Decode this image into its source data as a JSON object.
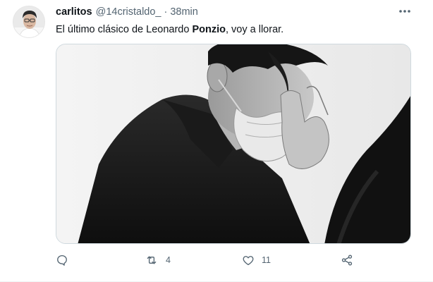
{
  "tweet": {
    "author_name": "carlitos",
    "author_handle": "@14cristaldo_",
    "separator": "·",
    "time": "38min",
    "text_before": "El último clásico de Leonardo ",
    "text_bold": "Ponzio",
    "text_after": ", voy a llorar.",
    "media_alt": "Imagen"
  },
  "actions": {
    "reply_count": "",
    "retweet_count": "4",
    "like_count": "11"
  },
  "icons": {
    "more": "more-icon",
    "reply": "reply-icon",
    "retweet": "retweet-icon",
    "like": "heart-icon",
    "share": "share-icon"
  },
  "colors": {
    "text": "#0f1419",
    "secondary": "#536471",
    "border": "#cfd9de"
  }
}
